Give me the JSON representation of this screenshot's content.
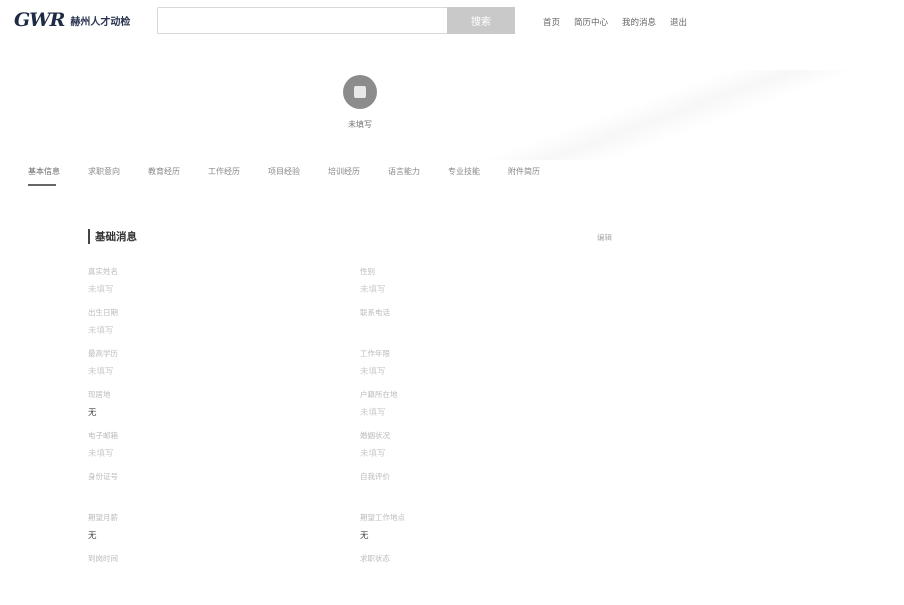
{
  "header": {
    "logo_mark": "GWR",
    "logo_text": "赫州人才动检",
    "search_placeholder": "",
    "search_button": "搜索",
    "nav": [
      "首页",
      "简历中心",
      "我的消息",
      "退出"
    ]
  },
  "profile": {
    "name": "未填写"
  },
  "tabs": [
    "基本信息",
    "求职意向",
    "教育经历",
    "工作经历",
    "项目经验",
    "培训经历",
    "语言能力",
    "专业技能",
    "附件简历"
  ],
  "section": {
    "title": "基础消息",
    "edit": "编辑"
  },
  "fields": [
    {
      "label": "真实姓名",
      "value": "未填写",
      "col": 0,
      "row": 0
    },
    {
      "label": "性别",
      "value": "未填写",
      "col": 1,
      "row": 0
    },
    {
      "label": "出生日期",
      "value": "未填写",
      "col": 0,
      "row": 1
    },
    {
      "label": "联系电话",
      "value": "",
      "col": 1,
      "row": 1
    },
    {
      "label": "最高学历",
      "value": "未填写",
      "col": 0,
      "row": 2
    },
    {
      "label": "工作年限",
      "value": "未填写",
      "col": 1,
      "row": 2
    },
    {
      "label": "现居地",
      "value": "无",
      "col": 0,
      "row": 3
    },
    {
      "label": "户籍所在地",
      "value": "未填写",
      "col": 1,
      "row": 3
    },
    {
      "label": "电子邮箱",
      "value": "未填写",
      "col": 0,
      "row": 4
    },
    {
      "label": "婚姻状况",
      "value": "未填写",
      "col": 1,
      "row": 4
    },
    {
      "label": "身份证号",
      "value": "",
      "col": 0,
      "row": 5
    },
    {
      "label": "自我评价",
      "value": "",
      "col": 1,
      "row": 5
    },
    {
      "label": "期望月薪",
      "value": "无",
      "col": 0,
      "row": 6
    },
    {
      "label": "期望工作地点",
      "value": "无",
      "col": 1,
      "row": 6
    },
    {
      "label": "到岗时间",
      "value": "",
      "col": 0,
      "row": 7
    },
    {
      "label": "求职状态",
      "value": "",
      "col": 1,
      "row": 7
    }
  ]
}
